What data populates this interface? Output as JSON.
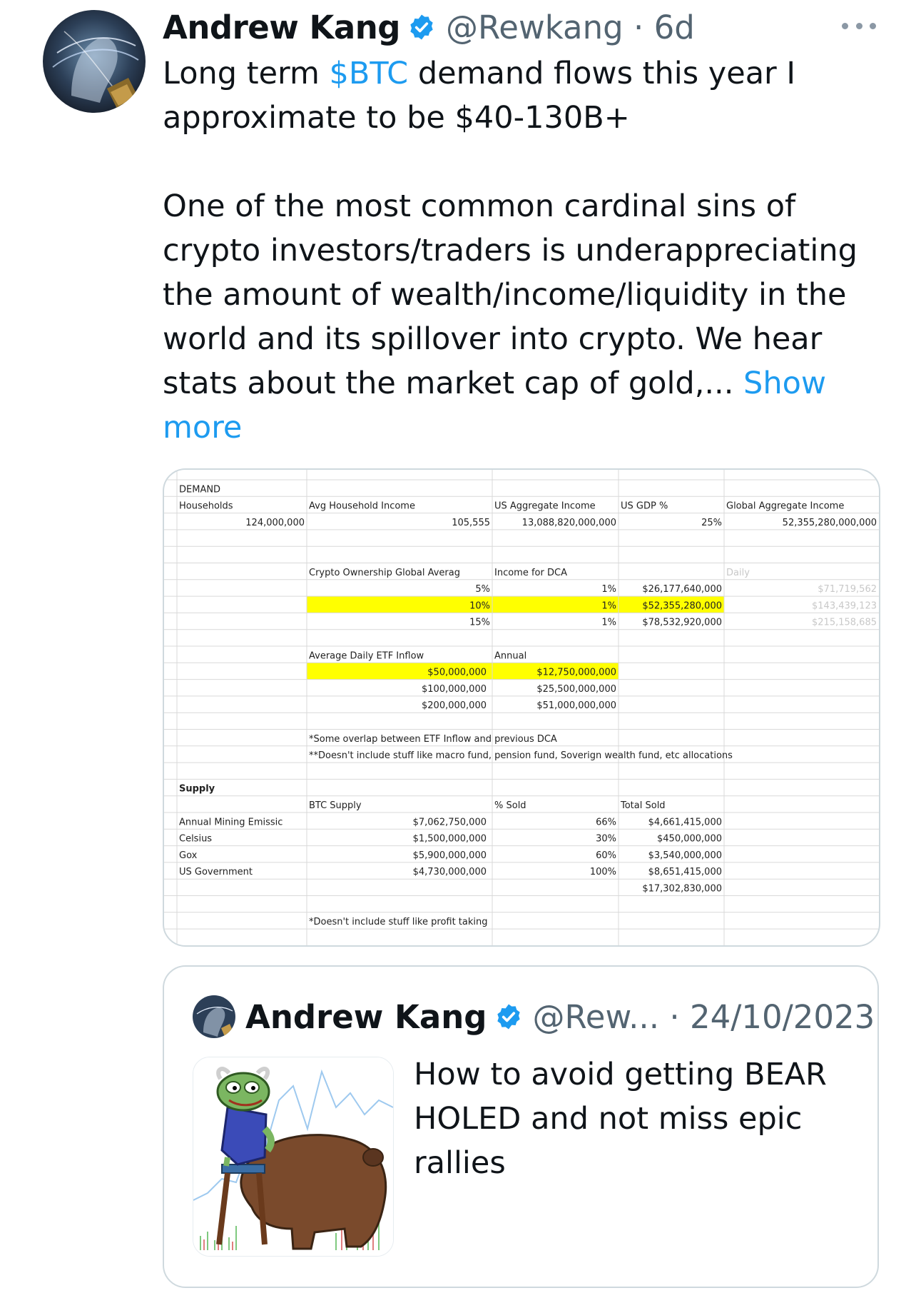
{
  "tweet": {
    "author_name": "Andrew Kang",
    "handle_time": "@Rewkang · 6d",
    "text_line1_prefix": "Long term ",
    "cashtag": "$BTC",
    "text_line1_suffix": " demand flows this year I approximate to be $40-130B+",
    "text_para2": "One of the most common cardinal sins of crypto investors/traders is underappreciating the amount of wealth/income/liquidity in the world and its spillover into crypto. We hear stats about the market cap of gold,... ",
    "show_more": "Show more"
  },
  "spreadsheet": {
    "demand_title": "DEMAND",
    "headers_row": [
      "Households",
      "Avg Household Income",
      "US Aggregate Income",
      "US GDP %",
      "Global Aggregate Income"
    ],
    "values_row": [
      "124,000,000",
      "105,555",
      "13,088,820,000,000",
      "25%",
      "52,355,280,000,000"
    ],
    "dca_header": [
      "Crypto Ownership Global Averag",
      "Income for DCA",
      "Daily"
    ],
    "dca_rows": [
      [
        "5%",
        "1%",
        "$26,177,640,000",
        "$71,719,562"
      ],
      [
        "10%",
        "1%",
        "$52,355,280,000",
        "$143,439,123"
      ],
      [
        "15%",
        "1%",
        "$78,532,920,000",
        "$215,158,685"
      ]
    ],
    "etf_header": [
      "Average Daily ETF Inflow",
      "Annual"
    ],
    "etf_rows": [
      [
        "$50,000,000",
        "$12,750,000,000"
      ],
      [
        "$100,000,000",
        "$25,500,000,000"
      ],
      [
        "$200,000,000",
        "$51,000,000,000"
      ]
    ],
    "notes": [
      "*Some overlap between ETF Inflow and previous DCA",
      "**Doesn't include stuff like macro fund, pension fund, Soverign wealth fund, etc allocations"
    ],
    "supply_title": "Supply",
    "supply_header": [
      "BTC Supply",
      "% Sold",
      "Total Sold"
    ],
    "supply_rows": [
      [
        "Annual Mining Emissic",
        "$7,062,750,000",
        "66%",
        "$4,661,415,000"
      ],
      [
        "Celsius",
        "$1,500,000,000",
        "30%",
        "$450,000,000"
      ],
      [
        "Gox",
        "$5,900,000,000",
        "60%",
        "$3,540,000,000"
      ],
      [
        "US Government",
        "$4,730,000,000",
        "100%",
        "$8,651,415,000"
      ]
    ],
    "supply_total": "$17,302,830,000",
    "supply_note": "*Doesn't include stuff like profit taking",
    "highlight_color": "#ffff00"
  },
  "quote": {
    "author_name": "Andrew Kang",
    "handle_time": "@Rew... · 24/10/2023",
    "text": "How to avoid getting BEAR HOLED and not miss epic rallies"
  },
  "icons": {
    "verified": "verified-badge-icon",
    "more": "more-options-icon"
  },
  "colors": {
    "link": "#1d9bf0",
    "verified": "#1d9bf0",
    "secondary_text": "#536471",
    "border": "#cfd9de"
  }
}
